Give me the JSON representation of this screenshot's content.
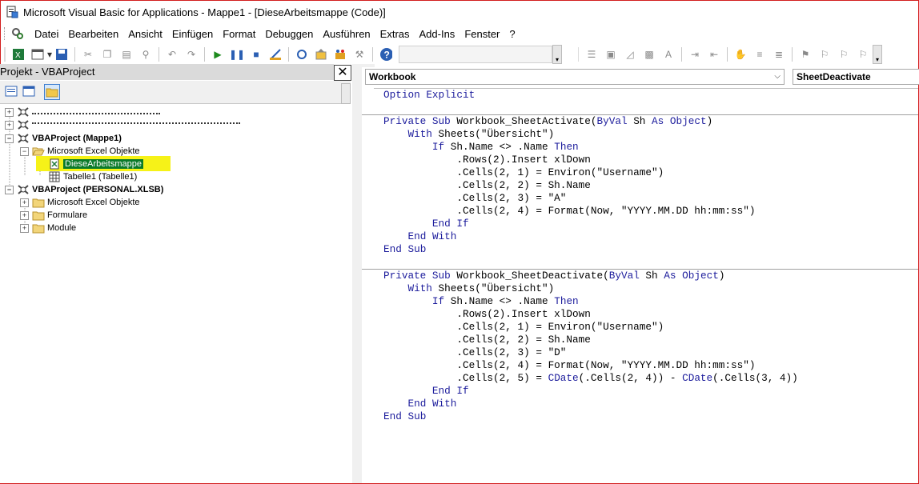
{
  "window": {
    "title": "Microsoft Visual Basic for Applications - Mappe1 - [DieseArbeitsmappe (Code)]"
  },
  "menu": [
    "Datei",
    "Bearbeiten",
    "Ansicht",
    "Einfügen",
    "Format",
    "Debuggen",
    "Ausführen",
    "Extras",
    "Add-Ins",
    "Fenster",
    "?"
  ],
  "colors": {
    "frame": "#d21e1e",
    "keyword": "#1c1c9c",
    "highlight": "#f6f218",
    "selected": "#0a7a2a"
  },
  "project_pane": {
    "title": "Projekt - VBAProject",
    "tree": [
      {
        "label": "VBAProject (Mappe1)"
      },
      {
        "label": "Microsoft Excel Objekte"
      },
      {
        "label": "DieseArbeitsmappe"
      },
      {
        "label": "Tabelle1 (Tabelle1)"
      },
      {
        "label": "VBAProject (PERSONAL.XLSB)"
      },
      {
        "label": "Microsoft Excel Objekte"
      },
      {
        "label": "Formulare"
      },
      {
        "label": "Module"
      }
    ]
  },
  "code_window": {
    "object_combo": "Workbook",
    "procedure_combo": "SheetDeactivate",
    "lines": [
      "Option Explicit",
      "",
      "Private Sub Workbook_SheetActivate(ByVal Sh As Object)",
      "    With Sheets(\"Übersicht\")",
      "        If Sh.Name <> .Name Then",
      "            .Rows(2).Insert xlDown",
      "            .Cells(2, 1) = Environ(\"Username\")",
      "            .Cells(2, 2) = Sh.Name",
      "            .Cells(2, 3) = \"A\"",
      "            .Cells(2, 4) = Format(Now, \"YYYY.MM.DD hh:mm:ss\")",
      "        End If",
      "    End With",
      "End Sub",
      "",
      "Private Sub Workbook_SheetDeactivate(ByVal Sh As Object)",
      "    With Sheets(\"Übersicht\")",
      "        If Sh.Name <> .Name Then",
      "            .Rows(2).Insert xlDown",
      "            .Cells(2, 1) = Environ(\"Username\")",
      "            .Cells(2, 2) = Sh.Name",
      "            .Cells(2, 3) = \"D\"",
      "            .Cells(2, 4) = Format(Now, \"YYYY.MM.DD hh:mm:ss\")",
      "            .Cells(2, 5) = CDate(.Cells(2, 4)) - CDate(.Cells(3, 4))",
      "        End If",
      "    End With",
      "End Sub"
    ]
  }
}
